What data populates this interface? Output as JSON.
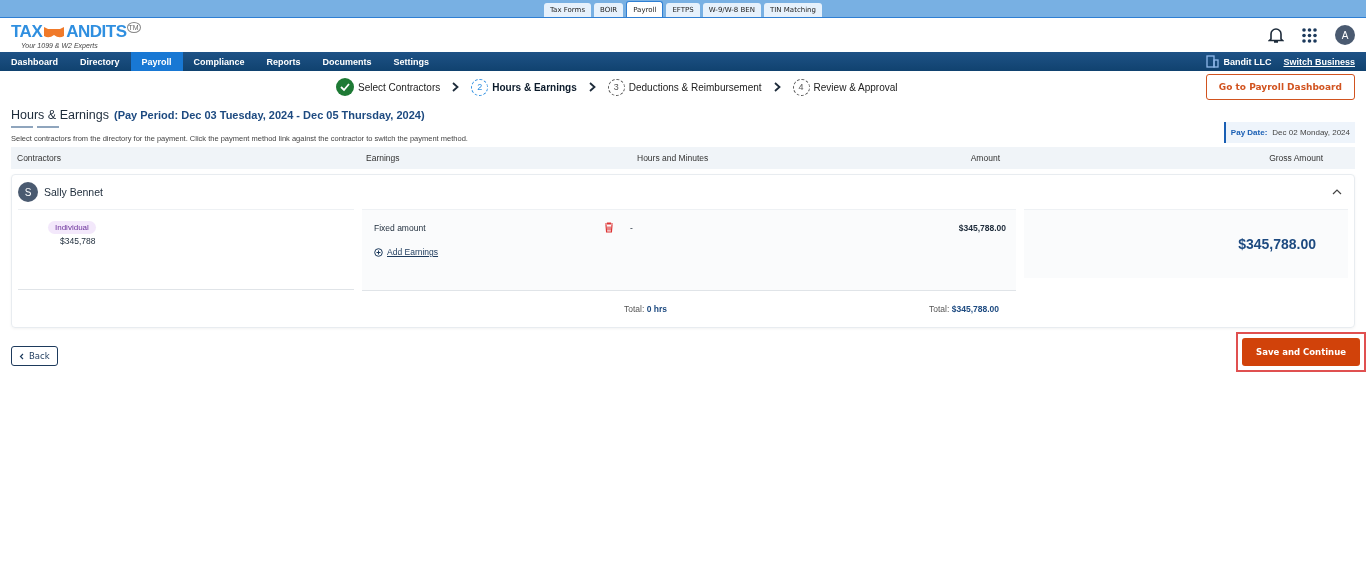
{
  "product_tabs": [
    {
      "label": "Tax Forms",
      "selected": false
    },
    {
      "label": "BOIR",
      "selected": false
    },
    {
      "label": "Payroll",
      "selected": true
    },
    {
      "label": "EFTPS",
      "selected": false
    },
    {
      "label": "W-9/W-8 BEN",
      "selected": false
    },
    {
      "label": "TIN Matching",
      "selected": false
    }
  ],
  "logo": {
    "left": "TAX",
    "right": "ANDITS",
    "trademark": "TM",
    "tagline": "Your 1099 & W2 Experts"
  },
  "header": {
    "avatar": "A"
  },
  "nav": {
    "items": [
      {
        "label": "Dashboard",
        "selected": false
      },
      {
        "label": "Directory",
        "selected": false
      },
      {
        "label": "Payroll",
        "selected": true
      },
      {
        "label": "Compliance",
        "selected": false
      },
      {
        "label": "Reports",
        "selected": false
      },
      {
        "label": "Documents",
        "selected": false
      },
      {
        "label": "Settings",
        "selected": false
      }
    ],
    "business": "Bandit LLC",
    "switch_link": "Switch Business"
  },
  "steps": [
    {
      "label": "Select Contractors",
      "completed": true,
      "current": false
    },
    {
      "number": "2",
      "label": "Hours & Earnings",
      "completed": false,
      "current": true
    },
    {
      "number": "3",
      "label": "Deductions & Reimbursement",
      "completed": false,
      "current": false
    },
    {
      "number": "4",
      "label": "Review & Approval",
      "completed": false,
      "current": false
    }
  ],
  "dashboard_button": "Go to Payroll Dashboard",
  "title": "Hours & Earnings",
  "pay_period": "(Pay Period: Dec 03 Tuesday, 2024 - Dec 05 Thursday, 2024)",
  "description": "Select contractors from the directory for the payment. Click the payment method link against the contractor to switch the payment method.",
  "pay_date": {
    "label": "Pay Date:",
    "value": "Dec 02 Monday, 2024"
  },
  "table": {
    "columns": [
      "Contractors",
      "Earnings",
      "Hours and Minutes",
      "Amount",
      "Gross Amount"
    ],
    "contractor": {
      "initial": "S",
      "name": "Sally Bennet",
      "expanded": true,
      "type": "Individual",
      "amount": "$345,788",
      "earnings": [
        {
          "label": "Fixed amount",
          "hours": "-",
          "amount": "$345,788.00"
        }
      ],
      "add_earnings": "Add Earnings",
      "gross": "$345,788.00",
      "hours_total_label": "Total:",
      "hours_total": "0 hrs",
      "amount_total_label": "Total:",
      "amount_total": "$345,788.00"
    }
  },
  "back_button": "Back",
  "save_button": {
    "label": "Save and Continue",
    "highlighted": true
  }
}
